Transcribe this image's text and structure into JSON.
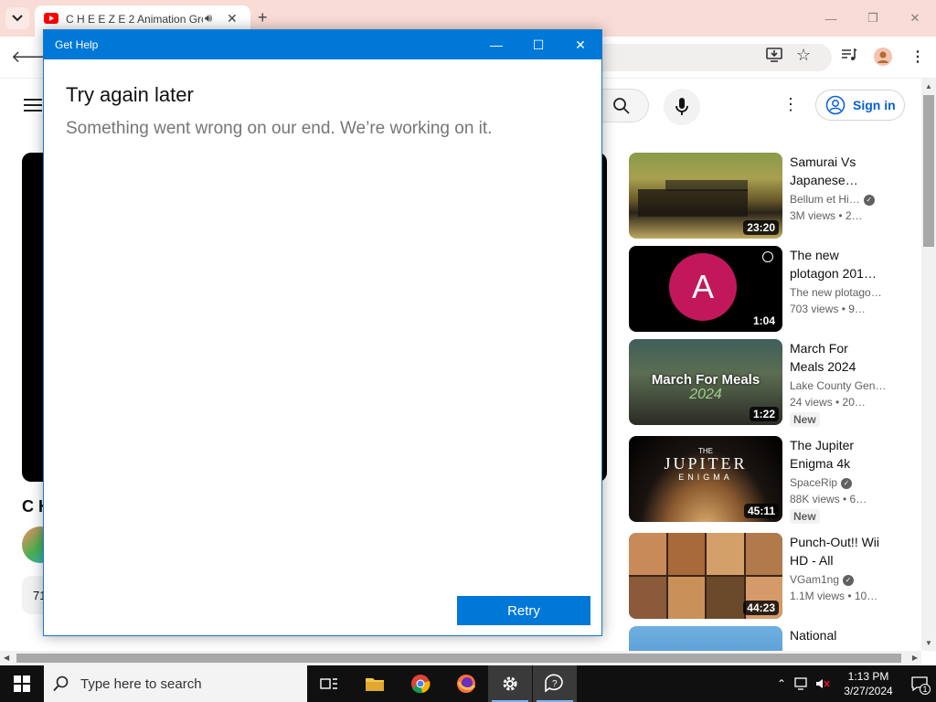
{
  "chrome": {
    "tab_title": "C H E E Z E 2 Animation Gro",
    "new_tab": "+",
    "close_tab": "✕"
  },
  "youtube": {
    "sign_in": "Sign in",
    "video_title_partial": "C H",
    "views_partial": "71"
  },
  "recommendations": [
    {
      "title": "Samurai Vs Japanese…",
      "channel": "Bellum et Hi…",
      "meta": "3M views  • 2…",
      "duration": "23:20",
      "verified": true,
      "new": false
    },
    {
      "title": "The new plotagon 201…",
      "channel": "The new plotago…",
      "meta": "703 views  • 9…",
      "duration": "1:04",
      "verified": false,
      "new": false
    },
    {
      "title": "March For Meals 2024",
      "channel": "Lake County Gen…",
      "meta": "24 views  • 20…",
      "duration": "1:22",
      "verified": false,
      "new": true,
      "new_label": "New"
    },
    {
      "title": "The Jupiter Enigma 4k",
      "channel": "SpaceRip",
      "meta": "88K views  • 6…",
      "duration": "45:11",
      "verified": true,
      "new": true,
      "new_label": "New"
    },
    {
      "title": "Punch-Out!! Wii HD - All Bosse…",
      "channel": "VGam1ng",
      "meta": "1.1M views  • 10…",
      "duration": "44:23",
      "verified": true,
      "new": false
    },
    {
      "title": "National",
      "channel": "",
      "meta": "",
      "duration": "",
      "verified": false,
      "new": false
    }
  ],
  "thumb_text": {
    "avatar_letter": "A",
    "march_text": "March For Meals",
    "march_year": "2024",
    "jupiter_the": "THE",
    "jupiter_main": "JUPITER",
    "jupiter_sub": "ENIGMA"
  },
  "dialog": {
    "title": "Get Help",
    "heading": "Try again later",
    "message": "Something went wrong on our end. We’re working on it.",
    "retry": "Retry"
  },
  "taskbar": {
    "search_placeholder": "Type here to search",
    "time": "1:13 PM",
    "date": "3/27/2024",
    "notification_count": "1"
  },
  "colors": {
    "accent": "#0078d7",
    "youtube_red": "#ff0000",
    "link_blue": "#065fd4"
  }
}
